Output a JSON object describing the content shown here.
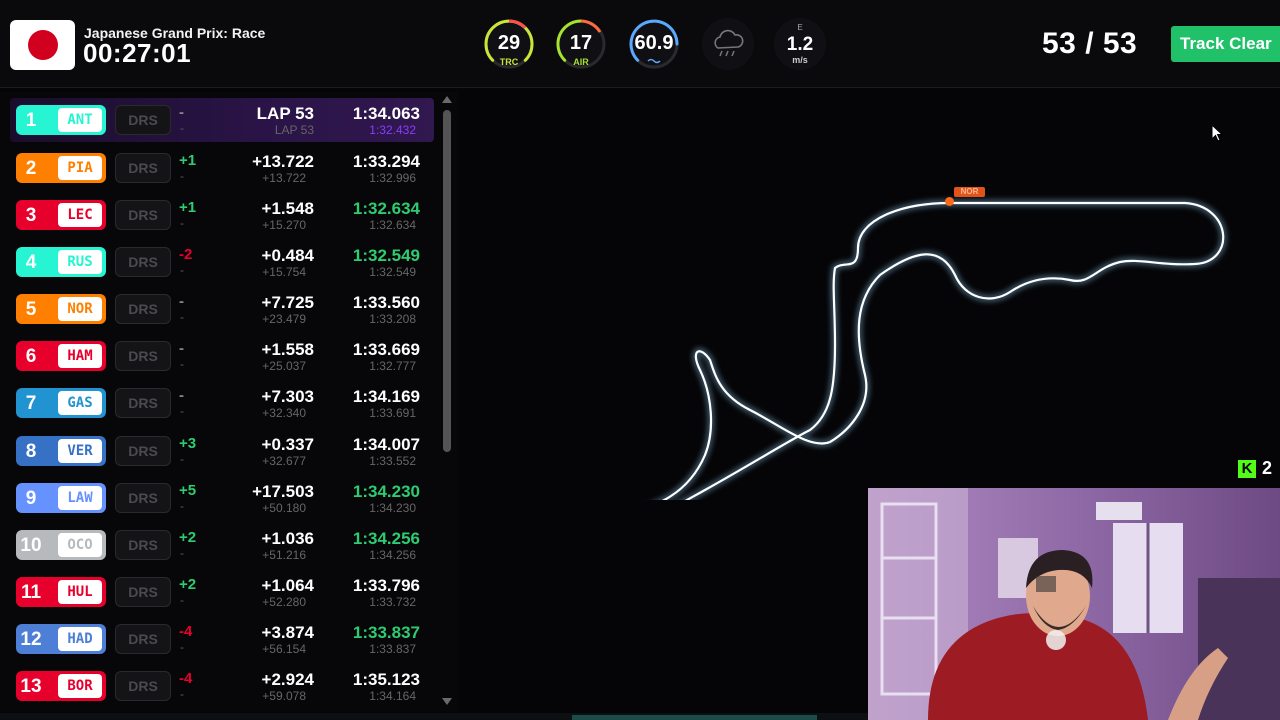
{
  "header": {
    "race_title": "Japanese Grand Prix: Race",
    "race_time": "00:27:01",
    "gauges": [
      {
        "value": "29",
        "label": "TRC",
        "color": "#c8e63a"
      },
      {
        "value": "17",
        "label": "AIR",
        "color": "#a6e22e"
      },
      {
        "value": "60.9",
        "label": "",
        "color": "#5aa9ff"
      }
    ],
    "weather_icon": "rain-cloud-icon",
    "wind": {
      "direction": "E",
      "value": "1.2",
      "unit": "m/s"
    },
    "lap_counter": "53 / 53",
    "track_status": "Track Clear"
  },
  "standings": [
    {
      "pos": "1",
      "code": "ANT",
      "team_color": "#27f4d2",
      "drs": "DRS",
      "change": "-",
      "change_color": "#888888",
      "change2": "-",
      "gap": "LAP 53",
      "gap2": "LAP 53",
      "lap": "1:34.063",
      "lap2": "1:32.432",
      "lap2_color": "#8a3cff"
    },
    {
      "pos": "2",
      "code": "PIA",
      "team_color": "#ff8000",
      "drs": "DRS",
      "change": "+1",
      "change_color": "#2ecc71",
      "change2": "-",
      "gap": "+13.722",
      "gap2": "+13.722",
      "lap": "1:33.294",
      "lap2": "1:32.996",
      "lap2_color": "#666666"
    },
    {
      "pos": "3",
      "code": "LEC",
      "team_color": "#e8002d",
      "drs": "DRS",
      "change": "+1",
      "change_color": "#2ecc71",
      "change2": "-",
      "gap": "+1.548",
      "gap2": "+15.270",
      "lap": "1:32.634",
      "lap2": "1:32.634",
      "lap2_color": "#666666",
      "lap_green": true
    },
    {
      "pos": "4",
      "code": "RUS",
      "team_color": "#27f4d2",
      "drs": "DRS",
      "change": "-2",
      "change_color": "#e8002d",
      "change2": "-",
      "gap": "+0.484",
      "gap2": "+15.754",
      "lap": "1:32.549",
      "lap2": "1:32.549",
      "lap2_color": "#666666",
      "lap_green": true
    },
    {
      "pos": "5",
      "code": "NOR",
      "team_color": "#ff8000",
      "drs": "DRS",
      "change": "-",
      "change_color": "#888888",
      "change2": "-",
      "gap": "+7.725",
      "gap2": "+23.479",
      "lap": "1:33.560",
      "lap2": "1:33.208",
      "lap2_color": "#666666"
    },
    {
      "pos": "6",
      "code": "HAM",
      "team_color": "#e8002d",
      "drs": "DRS",
      "change": "-",
      "change_color": "#888888",
      "change2": "-",
      "gap": "+1.558",
      "gap2": "+25.037",
      "lap": "1:33.669",
      "lap2": "1:32.777",
      "lap2_color": "#666666"
    },
    {
      "pos": "7",
      "code": "GAS",
      "team_color": "#2293d1",
      "drs": "DRS",
      "change": "-",
      "change_color": "#888888",
      "change2": "-",
      "gap": "+7.303",
      "gap2": "+32.340",
      "lap": "1:34.169",
      "lap2": "1:33.691",
      "lap2_color": "#666666"
    },
    {
      "pos": "8",
      "code": "VER",
      "team_color": "#3671c6",
      "drs": "DRS",
      "change": "+3",
      "change_color": "#2ecc71",
      "change2": "-",
      "gap": "+0.337",
      "gap2": "+32.677",
      "lap": "1:34.007",
      "lap2": "1:33.552",
      "lap2_color": "#666666"
    },
    {
      "pos": "9",
      "code": "LAW",
      "team_color": "#6692ff",
      "drs": "DRS",
      "change": "+5",
      "change_color": "#2ecc71",
      "change2": "-",
      "gap": "+17.503",
      "gap2": "+50.180",
      "lap": "1:34.230",
      "lap2": "1:34.230",
      "lap2_color": "#666666",
      "lap_green": true
    },
    {
      "pos": "10",
      "code": "OCO",
      "team_color": "#b6babd",
      "drs": "DRS",
      "change": "+2",
      "change_color": "#2ecc71",
      "change2": "-",
      "gap": "+1.036",
      "gap2": "+51.216",
      "lap": "1:34.256",
      "lap2": "1:34.256",
      "lap2_color": "#666666",
      "lap_green": true
    },
    {
      "pos": "11",
      "code": "HUL",
      "team_color": "#e8002d",
      "drs": "DRS",
      "change": "+2",
      "change_color": "#2ecc71",
      "change2": "-",
      "gap": "+1.064",
      "gap2": "+52.280",
      "lap": "1:33.796",
      "lap2": "1:33.732",
      "lap2_color": "#666666"
    },
    {
      "pos": "12",
      "code": "HAD",
      "team_color": "#4d7fd6",
      "drs": "DRS",
      "change": "-4",
      "change_color": "#e8002d",
      "change2": "-",
      "gap": "+3.874",
      "gap2": "+56.154",
      "lap": "1:33.837",
      "lap2": "1:33.837",
      "lap2_color": "#666666",
      "lap_green": true
    },
    {
      "pos": "13",
      "code": "BOR",
      "team_color": "#e8002d",
      "drs": "DRS",
      "change": "-4",
      "change_color": "#e8002d",
      "change2": "-",
      "gap": "+2.924",
      "gap2": "+59.078",
      "lap": "1:35.123",
      "lap2": "1:34.164",
      "lap2_color": "#666666"
    }
  ],
  "track": {
    "car_label": "NOR",
    "car_color": "#ff6a1a"
  },
  "kick": {
    "viewers": "2",
    "brand_color": "#53fc18"
  }
}
